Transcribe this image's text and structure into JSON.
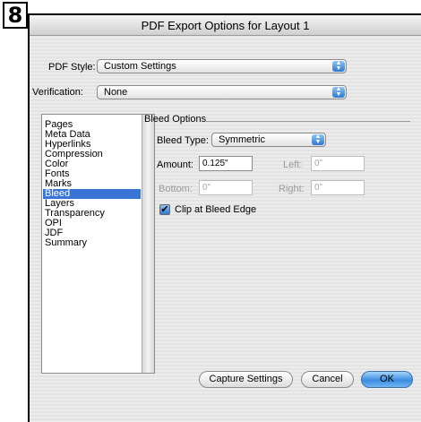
{
  "step": {
    "number": "8"
  },
  "window": {
    "title": "PDF Export Options for Layout 1"
  },
  "pdf_style": {
    "label": "PDF Style:",
    "value": "Custom Settings"
  },
  "verification": {
    "label": "Verification:",
    "value": "None"
  },
  "sidebar": {
    "items": [
      "Pages",
      "Meta Data",
      "Hyperlinks",
      "Compression",
      "Color",
      "Fonts",
      "Marks",
      "Bleed",
      "Layers",
      "Transparency",
      "OPI",
      "JDF",
      "Summary"
    ],
    "selected": "Bleed"
  },
  "bleed_options": {
    "title": "Bleed Options",
    "bleed_type": {
      "label": "Bleed Type:",
      "value": "Symmetric"
    },
    "amount": {
      "label": "Amount:",
      "value": "0.125\""
    },
    "left": {
      "label": "Left:",
      "value": "0\""
    },
    "bottom": {
      "label": "Bottom:",
      "value": "0\""
    },
    "right": {
      "label": "Right:",
      "value": "0\""
    },
    "clip": {
      "label": "Clip at Bleed Edge",
      "checked": true
    }
  },
  "buttons": {
    "capture": "Capture Settings",
    "cancel": "Cancel",
    "ok": "OK"
  },
  "colors": {
    "accent": "#3875d7",
    "ok_button": "#3b8ce0"
  }
}
